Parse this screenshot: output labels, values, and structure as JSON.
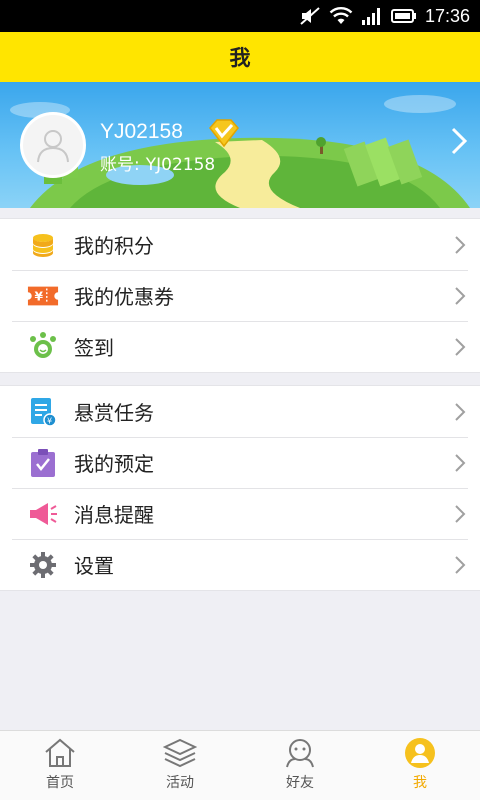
{
  "status_bar": {
    "time": "17:36"
  },
  "header": {
    "title": "我"
  },
  "profile": {
    "username": "YJ02158",
    "account_label": "账号:",
    "account_value": "YJ02158"
  },
  "menu_group_1": [
    {
      "label": "我的积分",
      "icon": "coins-icon"
    },
    {
      "label": "我的优惠券",
      "icon": "coupon-icon"
    },
    {
      "label": "签到",
      "icon": "checkin-icon"
    }
  ],
  "menu_group_2": [
    {
      "label": "悬赏任务",
      "icon": "task-icon"
    },
    {
      "label": "我的预定",
      "icon": "booking-icon"
    },
    {
      "label": "消息提醒",
      "icon": "megaphone-icon"
    },
    {
      "label": "设置",
      "icon": "gear-icon"
    }
  ],
  "tabs": [
    {
      "label": "首页",
      "icon": "home-icon",
      "active": false
    },
    {
      "label": "活动",
      "icon": "layers-icon",
      "active": false
    },
    {
      "label": "好友",
      "icon": "friends-icon",
      "active": false
    },
    {
      "label": "我",
      "icon": "profile-icon",
      "active": true
    }
  ],
  "colors": {
    "title_bar": "#ffe500",
    "banner_sky": "#3aa6ec",
    "active_tab": "#f2a900"
  }
}
